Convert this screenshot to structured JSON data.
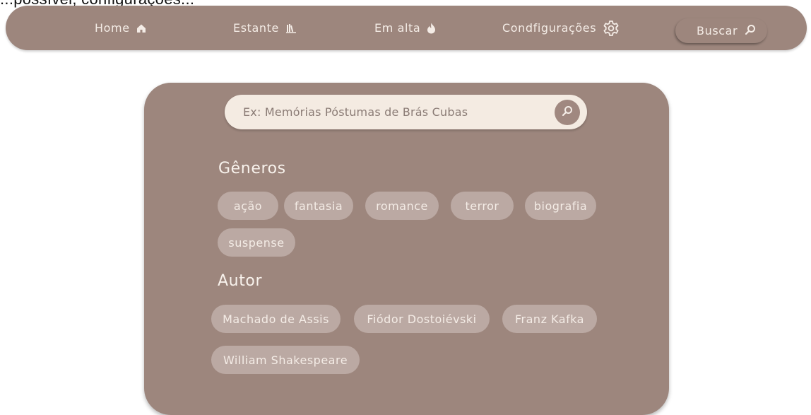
{
  "clipped_top_text": "...possível, configurações...",
  "colors": {
    "bar": "#9d867d",
    "panel": "#9d867d",
    "chip": "#bba9a3",
    "search_field": "#f4ebe2",
    "text_light": "#f4ece6"
  },
  "navbar": {
    "items": [
      {
        "label": "Home",
        "icon": "home-icon"
      },
      {
        "label": "Estante",
        "icon": "bookshelf-icon"
      },
      {
        "label": "Em alta",
        "icon": "flame-icon"
      },
      {
        "label": "Condfigurações",
        "icon": "gear-icon"
      }
    ],
    "search": {
      "label": "Buscar",
      "icon": "search-icon"
    }
  },
  "search": {
    "placeholder": "Ex: Memórias Póstumas de Brás Cubas",
    "icon": "search-icon"
  },
  "genres": {
    "title": "Gêneros",
    "items": [
      "ação",
      "fantasia",
      "romance",
      "terror",
      "biografia",
      "suspense"
    ]
  },
  "authors": {
    "title": "Autor",
    "items": [
      "Machado de Assis",
      "Fiódor Dostoiévski",
      "Franz Kafka",
      "William Shakespeare"
    ]
  }
}
